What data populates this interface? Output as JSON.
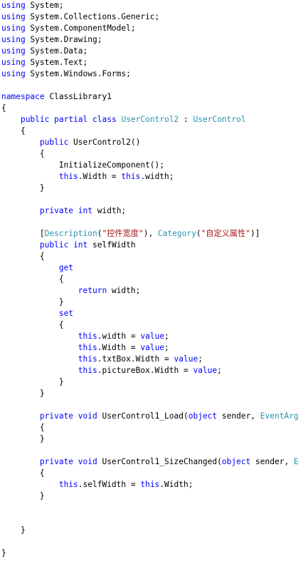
{
  "colors": {
    "keyword": "#0000ff",
    "type": "#2b91af",
    "string": "#a31515",
    "plain": "#000000",
    "background": "#ffffff"
  },
  "code_lines": [
    [
      {
        "t": "kw",
        "v": "using"
      },
      {
        "t": "plain",
        "v": " System;"
      }
    ],
    [
      {
        "t": "kw",
        "v": "using"
      },
      {
        "t": "plain",
        "v": " System.Collections.Generic;"
      }
    ],
    [
      {
        "t": "kw",
        "v": "using"
      },
      {
        "t": "plain",
        "v": " System.ComponentModel;"
      }
    ],
    [
      {
        "t": "kw",
        "v": "using"
      },
      {
        "t": "plain",
        "v": " System.Drawing;"
      }
    ],
    [
      {
        "t": "kw",
        "v": "using"
      },
      {
        "t": "plain",
        "v": " System.Data;"
      }
    ],
    [
      {
        "t": "kw",
        "v": "using"
      },
      {
        "t": "plain",
        "v": " System.Text;"
      }
    ],
    [
      {
        "t": "kw",
        "v": "using"
      },
      {
        "t": "plain",
        "v": " System.Windows.Forms;"
      }
    ],
    [],
    [
      {
        "t": "kw",
        "v": "namespace"
      },
      {
        "t": "plain",
        "v": " ClassLibrary1"
      }
    ],
    [
      {
        "t": "plain",
        "v": "{"
      }
    ],
    [
      {
        "t": "plain",
        "v": "    "
      },
      {
        "t": "kw",
        "v": "public"
      },
      {
        "t": "plain",
        "v": " "
      },
      {
        "t": "kw",
        "v": "partial"
      },
      {
        "t": "plain",
        "v": " "
      },
      {
        "t": "kw",
        "v": "class"
      },
      {
        "t": "plain",
        "v": " "
      },
      {
        "t": "type",
        "v": "UserControl2"
      },
      {
        "t": "plain",
        "v": " : "
      },
      {
        "t": "type",
        "v": "UserControl"
      }
    ],
    [
      {
        "t": "plain",
        "v": "    {"
      }
    ],
    [
      {
        "t": "plain",
        "v": "        "
      },
      {
        "t": "kw",
        "v": "public"
      },
      {
        "t": "plain",
        "v": " UserControl2()"
      }
    ],
    [
      {
        "t": "plain",
        "v": "        {"
      }
    ],
    [
      {
        "t": "plain",
        "v": "            InitializeComponent();"
      }
    ],
    [
      {
        "t": "plain",
        "v": "            "
      },
      {
        "t": "kw",
        "v": "this"
      },
      {
        "t": "plain",
        "v": ".Width = "
      },
      {
        "t": "kw",
        "v": "this"
      },
      {
        "t": "plain",
        "v": ".width;"
      }
    ],
    [
      {
        "t": "plain",
        "v": "        }"
      }
    ],
    [],
    [
      {
        "t": "plain",
        "v": "        "
      },
      {
        "t": "kw",
        "v": "private"
      },
      {
        "t": "plain",
        "v": " "
      },
      {
        "t": "kw",
        "v": "int"
      },
      {
        "t": "plain",
        "v": " width;"
      }
    ],
    [],
    [
      {
        "t": "plain",
        "v": "        ["
      },
      {
        "t": "type",
        "v": "Description"
      },
      {
        "t": "plain",
        "v": "("
      },
      {
        "t": "str",
        "v": "\"控件宽度\""
      },
      {
        "t": "plain",
        "v": "), "
      },
      {
        "t": "type",
        "v": "Category"
      },
      {
        "t": "plain",
        "v": "("
      },
      {
        "t": "str",
        "v": "\"自定义属性\""
      },
      {
        "t": "plain",
        "v": ")]"
      }
    ],
    [
      {
        "t": "plain",
        "v": "        "
      },
      {
        "t": "kw",
        "v": "public"
      },
      {
        "t": "plain",
        "v": " "
      },
      {
        "t": "kw",
        "v": "int"
      },
      {
        "t": "plain",
        "v": " selfWidth"
      }
    ],
    [
      {
        "t": "plain",
        "v": "        {"
      }
    ],
    [
      {
        "t": "plain",
        "v": "            "
      },
      {
        "t": "kw",
        "v": "get"
      }
    ],
    [
      {
        "t": "plain",
        "v": "            {"
      }
    ],
    [
      {
        "t": "plain",
        "v": "                "
      },
      {
        "t": "kw",
        "v": "return"
      },
      {
        "t": "plain",
        "v": " width;"
      }
    ],
    [
      {
        "t": "plain",
        "v": "            }"
      }
    ],
    [
      {
        "t": "plain",
        "v": "            "
      },
      {
        "t": "kw",
        "v": "set"
      }
    ],
    [
      {
        "t": "plain",
        "v": "            {"
      }
    ],
    [
      {
        "t": "plain",
        "v": "                "
      },
      {
        "t": "kw",
        "v": "this"
      },
      {
        "t": "plain",
        "v": ".width = "
      },
      {
        "t": "kw",
        "v": "value"
      },
      {
        "t": "plain",
        "v": ";"
      }
    ],
    [
      {
        "t": "plain",
        "v": "                "
      },
      {
        "t": "kw",
        "v": "this"
      },
      {
        "t": "plain",
        "v": ".Width = "
      },
      {
        "t": "kw",
        "v": "value"
      },
      {
        "t": "plain",
        "v": ";"
      }
    ],
    [
      {
        "t": "plain",
        "v": "                "
      },
      {
        "t": "kw",
        "v": "this"
      },
      {
        "t": "plain",
        "v": ".txtBox.Width = "
      },
      {
        "t": "kw",
        "v": "value"
      },
      {
        "t": "plain",
        "v": ";"
      }
    ],
    [
      {
        "t": "plain",
        "v": "                "
      },
      {
        "t": "kw",
        "v": "this"
      },
      {
        "t": "plain",
        "v": ".pictureBox.Width = "
      },
      {
        "t": "kw",
        "v": "value"
      },
      {
        "t": "plain",
        "v": ";"
      }
    ],
    [
      {
        "t": "plain",
        "v": "            }"
      }
    ],
    [
      {
        "t": "plain",
        "v": "        }"
      }
    ],
    [],
    [
      {
        "t": "plain",
        "v": "        "
      },
      {
        "t": "kw",
        "v": "private"
      },
      {
        "t": "plain",
        "v": " "
      },
      {
        "t": "kw",
        "v": "void"
      },
      {
        "t": "plain",
        "v": " UserControl1_Load("
      },
      {
        "t": "kw",
        "v": "object"
      },
      {
        "t": "plain",
        "v": " sender, "
      },
      {
        "t": "type",
        "v": "EventArg"
      }
    ],
    [
      {
        "t": "plain",
        "v": "        {"
      }
    ],
    [
      {
        "t": "plain",
        "v": "        }"
      }
    ],
    [],
    [
      {
        "t": "plain",
        "v": "        "
      },
      {
        "t": "kw",
        "v": "private"
      },
      {
        "t": "plain",
        "v": " "
      },
      {
        "t": "kw",
        "v": "void"
      },
      {
        "t": "plain",
        "v": " UserControl1_SizeChanged("
      },
      {
        "t": "kw",
        "v": "object"
      },
      {
        "t": "plain",
        "v": " sender, "
      },
      {
        "t": "type",
        "v": "E"
      }
    ],
    [
      {
        "t": "plain",
        "v": "        {"
      }
    ],
    [
      {
        "t": "plain",
        "v": "            "
      },
      {
        "t": "kw",
        "v": "this"
      },
      {
        "t": "plain",
        "v": ".selfWidth = "
      },
      {
        "t": "kw",
        "v": "this"
      },
      {
        "t": "plain",
        "v": ".Width;"
      }
    ],
    [
      {
        "t": "plain",
        "v": "        }"
      }
    ],
    [],
    [],
    [
      {
        "t": "plain",
        "v": "    }"
      }
    ],
    [],
    [
      {
        "t": "plain",
        "v": "}"
      }
    ]
  ]
}
